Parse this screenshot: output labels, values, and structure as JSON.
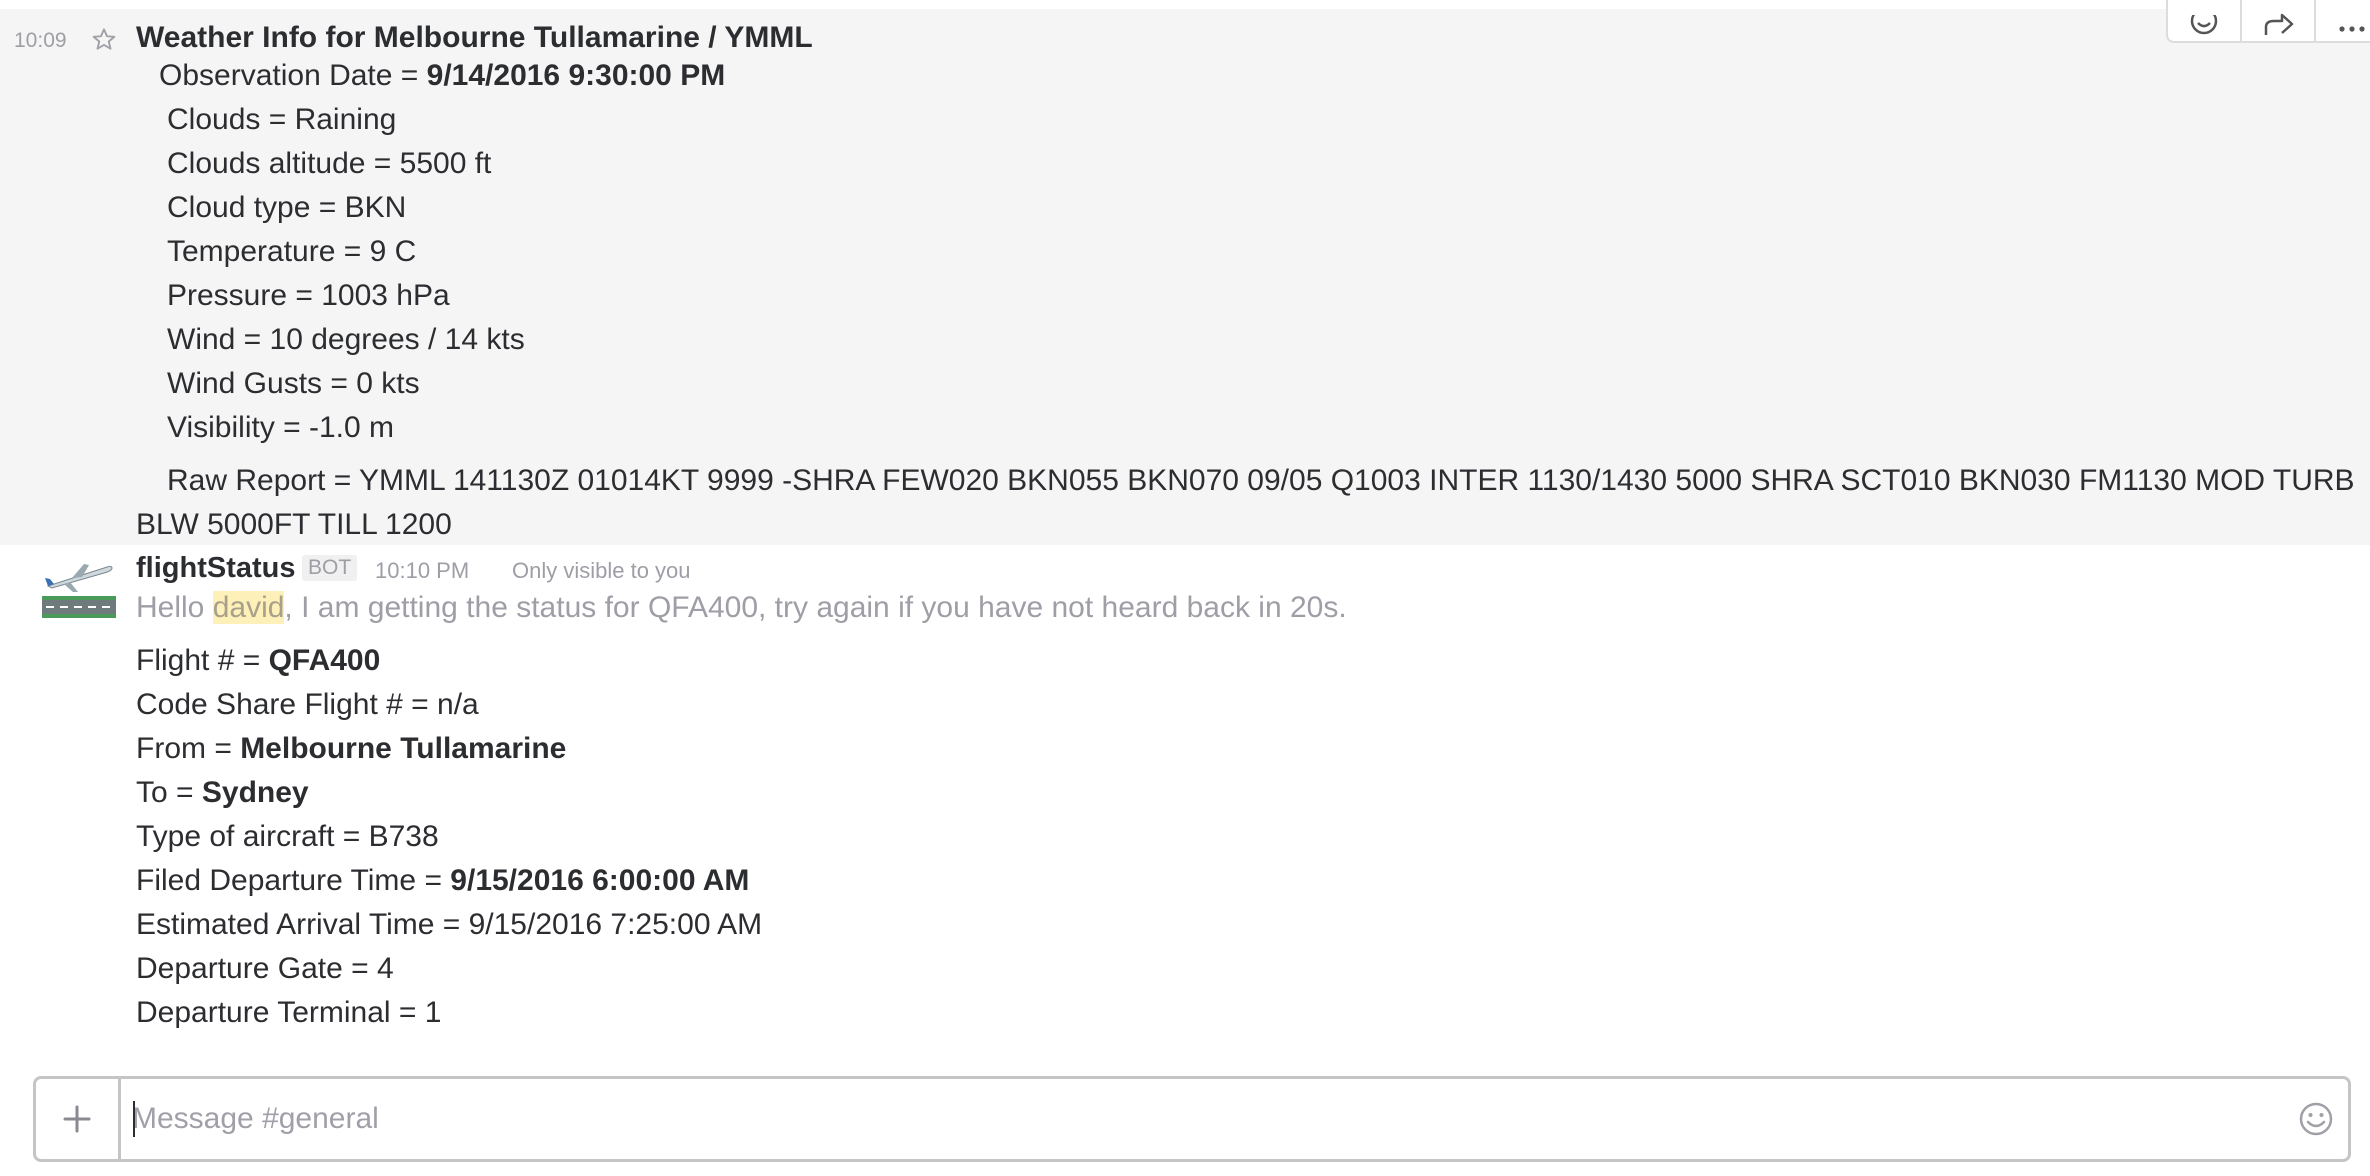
{
  "weather_message": {
    "time": "10:09",
    "title": "Weather Info for Melbourne Tullamarine / YMML",
    "observation_label": "Observation Date = ",
    "observation_value": "9/14/2016 9:30:00 PM",
    "lines": [
      "Clouds = Raining",
      "Clouds altitude = 5500 ft",
      "Cloud type = BKN",
      "Temperature = 9 C",
      "Pressure = 1003 hPa",
      "Wind = 10 degrees / 14 kts",
      "Wind Gusts = 0 kts",
      "Visibility = -1.0 m"
    ],
    "raw_report": "Raw Report = YMML 141130Z 01014KT 9999 -SHRA FEW020 BKN055 BKN070 09/05 Q1003 INTER 1130/1430 5000 SHRA SCT010 BKN030 FM1130 MOD TURB BLW 5000FT TILL 1200"
  },
  "actions": {
    "icons": [
      "emoji-reaction-icon",
      "share-icon",
      "more-icon"
    ]
  },
  "bot_message": {
    "sender": "flightStatus",
    "badge": "BOT",
    "time": "10:10 PM",
    "visibility_note": "Only visible to you",
    "ephemeral_prefix": "Hello ",
    "mention": "david",
    "ephemeral_suffix": ", I am getting the status for QFA400, try again if you have not heard back in 20s.",
    "fields": {
      "flight_label": "Flight # = ",
      "flight_value": "QFA400",
      "codeshare": "Code Share Flight # = n/a",
      "from_label": "From = ",
      "from_value": "Melbourne Tullamarine",
      "to_label": "To = ",
      "to_value": "Sydney",
      "aircraft": "Type of aircraft = B738",
      "filed_label": "Filed Departure Time = ",
      "filed_value": "9/15/2016 6:00:00 AM",
      "arrival": "Estimated Arrival Time = 9/15/2016 7:25:00 AM",
      "gate": "Departure Gate = 4",
      "terminal": "Departure Terminal = 1"
    }
  },
  "composer": {
    "placeholder": "Message #general",
    "value": ""
  },
  "colors": {
    "text": "#2c2d30",
    "muted": "#9e9ea6",
    "hover_bg": "#f5f5f5",
    "mention_bg": "#fdf0b8",
    "border": "#c5c5c5"
  }
}
